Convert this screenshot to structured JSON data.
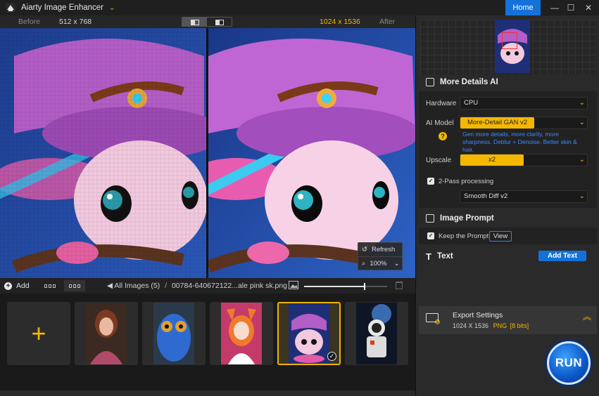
{
  "app": {
    "title": "Aiarty Image Enhancer"
  },
  "window": {
    "home": "Home",
    "minimize": "—",
    "maximize": "☐",
    "close": "✕"
  },
  "compare": {
    "before_label": "Before",
    "before_size": "512 x 768",
    "after_size": "1024 x 1536",
    "after_label": "After"
  },
  "overlay": {
    "refresh": "Refresh",
    "zoom": "100%"
  },
  "toolbar": {
    "add": "Add",
    "all_images": "All Images (5)",
    "separator": "/",
    "file_name": "00784-640672122...ale pink sk.png",
    "thumb_size_fraction": 0.72
  },
  "thumbnails": [
    {
      "name": "woman-portrait"
    },
    {
      "name": "owl"
    },
    {
      "name": "anime-girl"
    },
    {
      "name": "pink-axolotl",
      "selected": true
    },
    {
      "name": "astronaut"
    }
  ],
  "panel": {
    "section_title": "More Details AI",
    "hardware_label": "Hardware",
    "hardware_value": "CPU",
    "model_label": "AI Model",
    "model_value": "More-Detail GAN v2",
    "model_help": "?",
    "model_desc": "Gen more details, more clarity, more sharpness. Deblur + Denoise. Better skin & hair.",
    "upscale_label": "Upscale",
    "upscale_value": "x2",
    "twopass_label": "2-Pass processing",
    "twopass_checked": true,
    "twopass_value": "Smooth Diff v2",
    "prompt_title": "Image Prompt",
    "keep_prompt_label": "Keep the Prompt",
    "view_button": "View",
    "text_title": "Text",
    "add_text_button": "Add Text"
  },
  "export": {
    "title": "Export Settings",
    "size": "1024 X 1536",
    "format": "PNG",
    "bits": "[8 bits]"
  },
  "run": "RUN",
  "colors": {
    "accent": "#f5b800",
    "primary": "#1471d8",
    "bg": "#1b1b1b"
  }
}
